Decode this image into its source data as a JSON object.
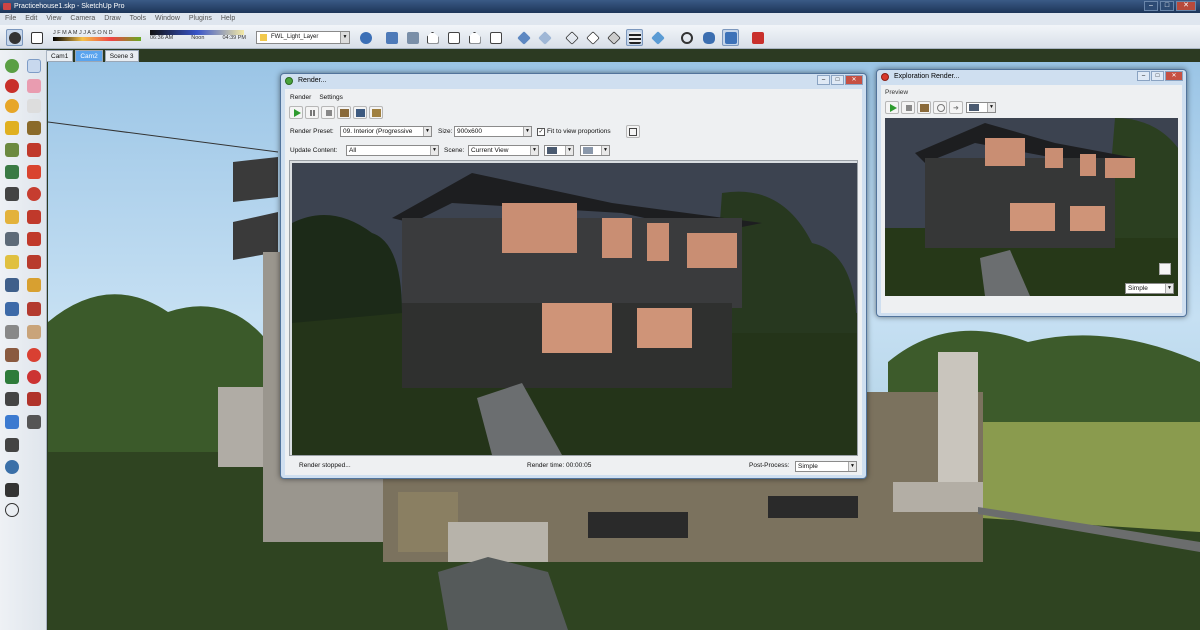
{
  "app": {
    "title": "Practicehouse1.skp - SketchUp Pro"
  },
  "menu": [
    "File",
    "Edit",
    "View",
    "Camera",
    "Draw",
    "Tools",
    "Window",
    "Plugins",
    "Help"
  ],
  "toolbar": {
    "shadow_months": "J F M A M J J A S O N D",
    "time_start": "06:36 AM",
    "time_mid": "Noon",
    "time_end": "04:39 PM",
    "layer_value": "FWL_Light_Layer"
  },
  "scenes": [
    "Cam1",
    "Cam2",
    "Scene 3"
  ],
  "render_dialog": {
    "title": "Render...",
    "menu": [
      "Render",
      "Settings"
    ],
    "preset_label": "Render Preset:",
    "preset_value": "09. Interior (Progressive",
    "size_label": "Size:",
    "size_value": "900x600",
    "fit_label": "Fit to view proportions",
    "update_label": "Update Content:",
    "update_value": "All",
    "scene_label": "Scene:",
    "scene_value": "Current View",
    "status_left": "Render stopped...",
    "status_mid": "Render time: 00:00:05",
    "postprocess_label": "Post-Process:",
    "postprocess_value": "Simple"
  },
  "exploration_dialog": {
    "title": "Exploration Render...",
    "tab": "Preview",
    "mode_value": "Simple"
  },
  "colors": {
    "titlebar": "#1d3558",
    "dialog_frame": "#cfdff0",
    "active_tab": "#5aa4ee"
  }
}
